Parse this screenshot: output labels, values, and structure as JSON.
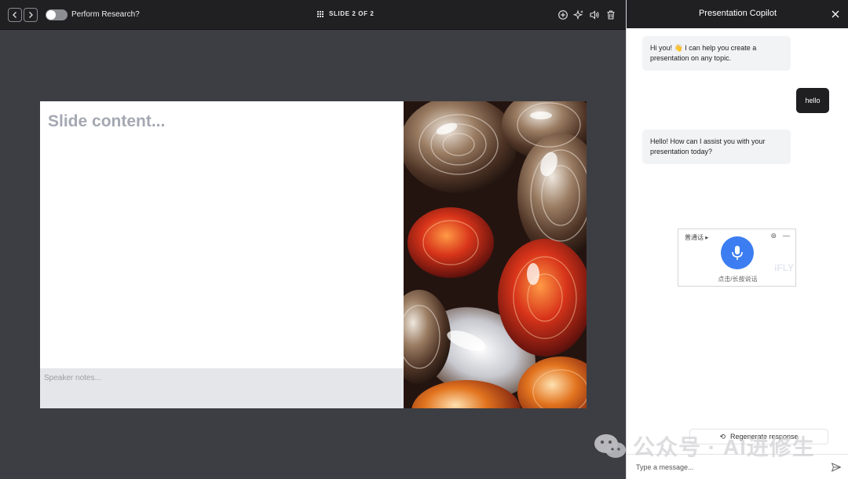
{
  "topbar": {
    "research_toggle_label": "Perform Research?",
    "research_enabled": false,
    "slide_counter": "SLIDE 2 OF 2"
  },
  "slide": {
    "title_placeholder": "Slide content...",
    "notes_placeholder": "Speaker notes...",
    "image_subject": "polished agate stones"
  },
  "panel": {
    "title": "Presentation Copilot",
    "messages": [
      {
        "role": "assistant",
        "text": "Hi you! 👋 I can help you create a presentation on any topic."
      },
      {
        "role": "user",
        "text": "hello"
      },
      {
        "role": "assistant",
        "text": "Hello! How can I assist you with your presentation today?"
      }
    ],
    "voice_widget": {
      "language": "普通话",
      "hint": "点击/长按说话",
      "logo": "iFLY"
    },
    "regenerate_label": "Regenerate response",
    "input_placeholder": "Type a message..."
  },
  "watermark": {
    "text": "公众号 · AI进修生"
  },
  "colors": {
    "topbar_bg": "#202022",
    "canvas_bg": "#3d3e43",
    "mic_blue": "#3c7ef2",
    "user_bubble": "#1f1f21",
    "ai_bubble": "#f2f3f5"
  }
}
